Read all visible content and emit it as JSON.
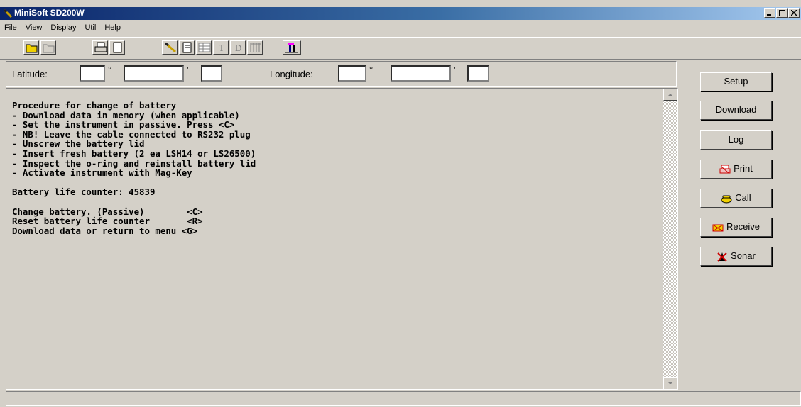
{
  "window": {
    "title": "MiniSoft SD200W"
  },
  "menu": [
    "File",
    "View",
    "Display",
    "Util",
    "Help"
  ],
  "toolbar": {
    "buttons": [
      "open-folder-icon",
      "open-file-icon",
      "print-icon",
      "document-icon",
      "probe-icon",
      "page-icon",
      "table-icon",
      "text-T-icon",
      "D-icon",
      "grid-icon",
      "instrument-icon"
    ]
  },
  "coords": {
    "lat_label": "Latitude:",
    "lon_label": "Longitude:",
    "degree": "°",
    "minute": "'"
  },
  "terminal": {
    "lines": [
      "Procedure for change of battery",
      "- Download data in memory (when applicable)",
      "- Set the instrument in passive. Press <C>",
      "- NB! Leave the cable connected to RS232 plug",
      "- Unscrew the battery lid",
      "- Insert fresh battery (2 ea LSH14 or LS26500)",
      "- Inspect the o-ring and reinstall battery lid",
      "- Activate instrument with Mag-Key",
      "",
      "Battery life counter: 45839",
      "",
      "Change battery. (Passive)        <C>",
      "Reset battery life counter       <R>",
      "Download data or return to menu <G>"
    ]
  },
  "sidebar": {
    "setup": "Setup",
    "download": "Download",
    "log": "Log",
    "print": "Print",
    "call": "Call",
    "receive": "Receive",
    "sonar": "Sonar"
  },
  "status": {
    "text": ""
  }
}
